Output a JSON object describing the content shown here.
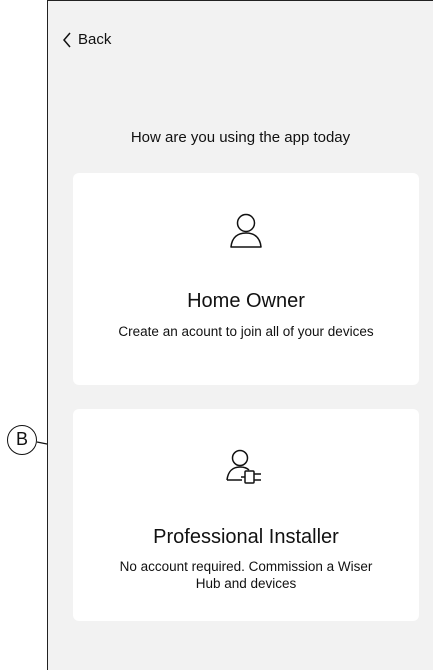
{
  "header": {
    "back_label": "Back"
  },
  "main": {
    "prompt": "How are you using the app today",
    "options": [
      {
        "icon": "user-icon",
        "title": "Home Owner",
        "description": "Create an acount to join all of your devices"
      },
      {
        "icon": "user-plug-icon",
        "title": "Professional Installer",
        "description": "No account required. Commission a Wiser Hub and devices"
      }
    ]
  },
  "annotation": {
    "callout_label": "B"
  },
  "colors": {
    "screen_background": "#f2f2f2",
    "card_background": "#ffffff",
    "text": "#111111"
  }
}
